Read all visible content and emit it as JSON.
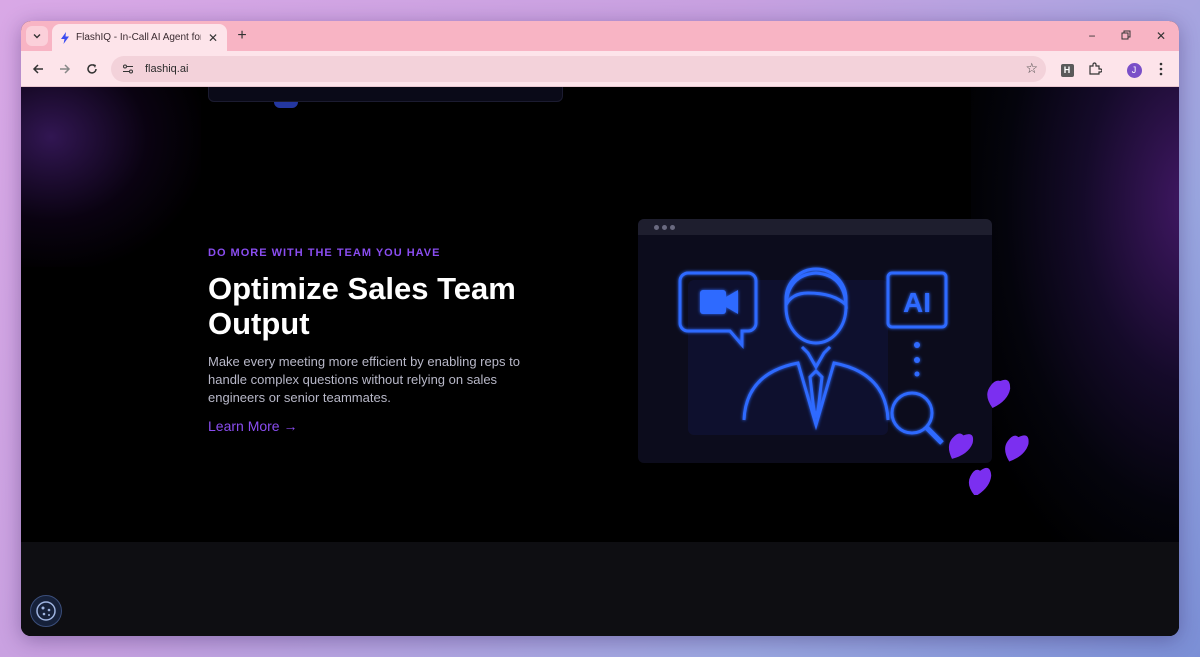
{
  "browser": {
    "tab_title": "FlashIQ - In-Call AI Agent for Sa",
    "url": "flashiq.ai",
    "extension_label": "H",
    "profile_initial": "J"
  },
  "hero": {
    "eyebrow": "DO MORE WITH THE TEAM YOU HAVE",
    "headline": "Optimize Sales Team Output",
    "description": "Make every meeting more efficient by enabling reps to handle complex questions without relying on sales engineers or senior teammates.",
    "link_label": "Learn More →"
  },
  "illustration": {
    "ai_badge": "AI"
  },
  "colors": {
    "accent": "#8a4df0",
    "illustration_blue": "#2f6bff",
    "heart_purple": "#7b2ff0"
  }
}
